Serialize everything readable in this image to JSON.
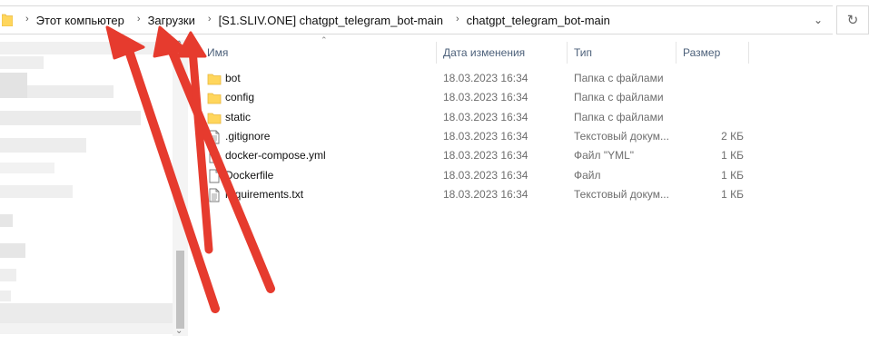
{
  "address_bar": {
    "breadcrumbs": [
      "Этот компьютер",
      "Загрузки",
      "[S1.SLIV.ONE] chatgpt_telegram_bot-main",
      "chatgpt_telegram_bot-main"
    ],
    "dropdown_glyph": "⌄",
    "refresh_glyph": "↻"
  },
  "columns": {
    "name": "Имя",
    "date": "Дата изменения",
    "type": "Тип",
    "size": "Размер"
  },
  "files": [
    {
      "name": "bot",
      "date": "18.03.2023 16:34",
      "type": "Папка с файлами",
      "size": "",
      "icon": "folder-icon"
    },
    {
      "name": "config",
      "date": "18.03.2023 16:34",
      "type": "Папка с файлами",
      "size": "",
      "icon": "folder-icon"
    },
    {
      "name": "static",
      "date": "18.03.2023 16:34",
      "type": "Папка с файлами",
      "size": "",
      "icon": "folder-icon"
    },
    {
      "name": ".gitignore",
      "date": "18.03.2023 16:34",
      "type": "Текстовый докум...",
      "size": "2 КБ",
      "icon": "text-file-icon"
    },
    {
      "name": "docker-compose.yml",
      "date": "18.03.2023 16:34",
      "type": "Файл \"YML\"",
      "size": "1 КБ",
      "icon": "file-icon"
    },
    {
      "name": "Dockerfile",
      "date": "18.03.2023 16:34",
      "type": "Файл",
      "size": "1 КБ",
      "icon": "file-icon"
    },
    {
      "name": "requirements.txt",
      "date": "18.03.2023 16:34",
      "type": "Текстовый докум...",
      "size": "1 КБ",
      "icon": "text-file-icon"
    }
  ],
  "colors": {
    "folder": "#ffd65c",
    "folder_dark": "#e8b73e",
    "arrow": "#e63b2e",
    "header_text": "#4c607a"
  }
}
